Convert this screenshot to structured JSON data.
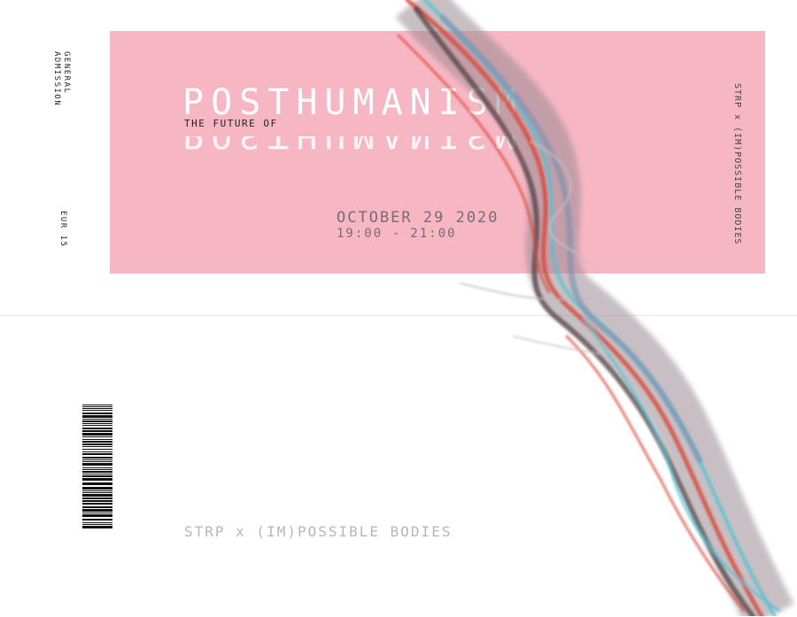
{
  "ticket": {
    "admission_line1": "GENERAL",
    "admission_line2": "ADMISSION",
    "price": "EUR 15",
    "title_small": "THE FUTURE OF",
    "title_big": "POSTHUMANISM",
    "date": "OCTOBER 29 2020",
    "time": "19:00 - 21:00",
    "side_credit": "STRP x (IM)POSSIBLE BODIES",
    "back_credit": "STRP x (IM)POSSIBLE BODIES"
  },
  "colors": {
    "panel": "#f7b6c3",
    "fiber_red": "#d9483a",
    "fiber_cyan": "#4fc3d6",
    "fiber_dark": "#4b3a3e"
  },
  "icons": [
    "barcode-icon",
    "fiber-artwork"
  ]
}
